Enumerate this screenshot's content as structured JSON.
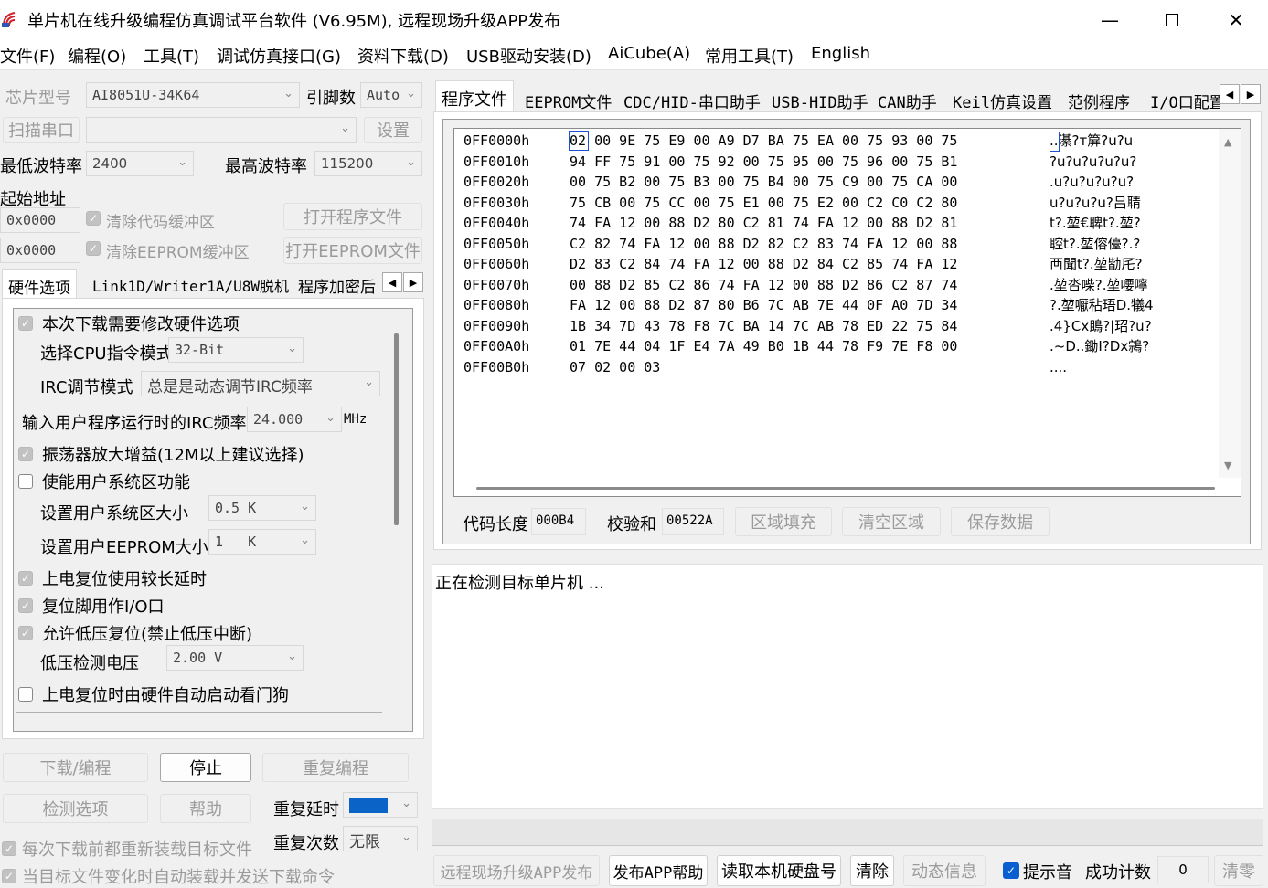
{
  "window": {
    "title": "单片机在线升级编程仿真调试平台软件 (V6.95M), 远程现场升级APP发布"
  },
  "menu": [
    "文件(F)",
    "编程(O)",
    "工具(T)",
    "调试仿真接口(G)",
    "资料下载(D)",
    "USB驱动安装(D)",
    "AiCube(A)",
    "常用工具(T)",
    "English"
  ],
  "left": {
    "chip_label": "芯片型号",
    "chip_value": "AI8051U-34K64",
    "pins_label": "引脚数",
    "pins_value": "Auto",
    "scan_port": "扫描串口",
    "settings": "设置",
    "min_baud_label": "最低波特率",
    "min_baud": "2400",
    "max_baud_label": "最高波特率",
    "max_baud": "115200",
    "start_addr_label": "起始地址",
    "addr1": "0x0000",
    "addr2": "0x0000",
    "clear_code": "清除代码缓冲区",
    "clear_eeprom": "清除EEPROM缓冲区",
    "open_prog": "打开程序文件",
    "open_eeprom": "打开EEPROM文件",
    "tabs": [
      "硬件选项",
      "Link1D/Writer1A/U8W脱机",
      "程序加密后"
    ],
    "hw": {
      "opt_modify": "本次下载需要修改硬件选项",
      "cpu_mode_label": "选择CPU指令模式",
      "cpu_mode": "32-Bit",
      "irc_mode_label": "IRC调节模式",
      "irc_mode": "总是是动态调节IRC频率",
      "irc_freq_label": "输入用户程序运行时的IRC频率",
      "irc_freq": "24.000",
      "mhz": "MHz",
      "osc_gain": "振荡器放大增益(12M以上建议选择)",
      "enable_sys": "使能用户系统区功能",
      "sys_size_label": "设置用户系统区大小",
      "sys_size": "0.5 K",
      "eeprom_size_label": "设置用户EEPROM大小",
      "eeprom_size": "1   K",
      "long_delay": "上电复位使用较长延时",
      "reset_io": "复位脚用作I/O口",
      "lvd_reset": "允许低压复位(禁止低压中断)",
      "lvd_volt_label": "低压检测电压",
      "lvd_volt": "2.00 V",
      "wdt": "上电复位时由硬件自动启动看门狗"
    },
    "btn_download": "下载/编程",
    "btn_stop": "停止",
    "btn_reprog": "重复编程",
    "btn_detect": "检测选项",
    "btn_help": "帮助",
    "repeat_delay_label": "重复延时",
    "repeat_count_label": "重复次数",
    "repeat_count": "无限",
    "reload_each": "每次下载前都重新装载目标文件",
    "auto_reload": "当目标文件变化时自动装载并发送下载命令"
  },
  "right": {
    "tabs": [
      "程序文件",
      "EEPROM文件",
      "CDC/HID-串口助手",
      "USB-HID助手",
      "CAN助手",
      "Keil仿真设置",
      "范例程序",
      "I/O口配置"
    ],
    "hex": [
      {
        "addr": "0FF0000h",
        "bytes": "02 00 9E 75 E9 00 A9 D7 BA 75 EA 00 75 93 00 75",
        "ascii": "..濝?т箳?u?u"
      },
      {
        "addr": "0FF0010h",
        "bytes": "94 FF 75 91 00 75 92 00 75 95 00 75 96 00 75 B1",
        "ascii": "?u?u?u?u?u?"
      },
      {
        "addr": "0FF0020h",
        "bytes": "00 75 B2 00 75 B3 00 75 B4 00 75 C9 00 75 CA 00",
        "ascii": ".u?u?u?u?u?"
      },
      {
        "addr": "0FF0030h",
        "bytes": "75 CB 00 75 CC 00 75 E1 00 75 E2 00 C2 C0 C2 80",
        "ascii": "u?u?u?u?吕聙"
      },
      {
        "addr": "0FF0040h",
        "bytes": "74 FA 12 00 88 D2 80 C2 81 74 FA 12 00 88 D2 81",
        "ascii": "t?.堃€聛t?.堃?"
      },
      {
        "addr": "0FF0050h",
        "bytes": "C2 82 74 FA 12 00 88 D2 82 C2 83 74 FA 12 00 88",
        "ascii": "聜t?.堃傛儓?.?"
      },
      {
        "addr": "0FF0060h",
        "bytes": "D2 83 C2 84 74 FA 12 00 88 D2 84 C2 85 74 FA 12",
        "ascii": "襾聞t?.堃勓厇?"
      },
      {
        "addr": "0FF0070h",
        "bytes": "00 88 D2 85 C2 86 74 FA 12 00 88 D2 86 C2 87 74",
        "ascii": ".堃呇喍?.堃喓嚀"
      },
      {
        "addr": "0FF0080h",
        "bytes": "FA 12 00 88 D2 87 80 B6 7C AB 7E 44 0F A0 7D 34",
        "ascii": "?.堃嚈秥珸D.犠4"
      },
      {
        "addr": "0FF0090h",
        "bytes": "1B 34 7D 43 78 F8 7C BA 14 7C AB 78 ED 22 75 84",
        "ascii": ".4}Cx鴡?|玿?u?"
      },
      {
        "addr": "0FF00A0h",
        "bytes": "01 7E 44 04 1F E4 7A 49 B0 1B 44 78 F9 7E F8 00",
        "ascii": ".~D..鋤I?Dx鶎?"
      },
      {
        "addr": "0FF00B0h",
        "bytes": "07 02 00 03",
        "ascii": "...."
      }
    ],
    "code_len_label": "代码长度",
    "code_len": "000B4",
    "checksum_label": "校验和",
    "checksum": "00522A",
    "fill_area": "区域填充",
    "clear_area": "清空区域",
    "save_data": "保存数据",
    "log_text": "正在检测目标单片机 ...",
    "bottom": {
      "publish": "远程现场升级APP发布",
      "publish_help": "发布APP帮助",
      "read_disk": "读取本机硬盘号",
      "clear": "清除",
      "dynamic_info": "动态信息",
      "sound": "提示音",
      "success_label": "成功计数",
      "success_count": "0",
      "reset": "清零"
    }
  }
}
